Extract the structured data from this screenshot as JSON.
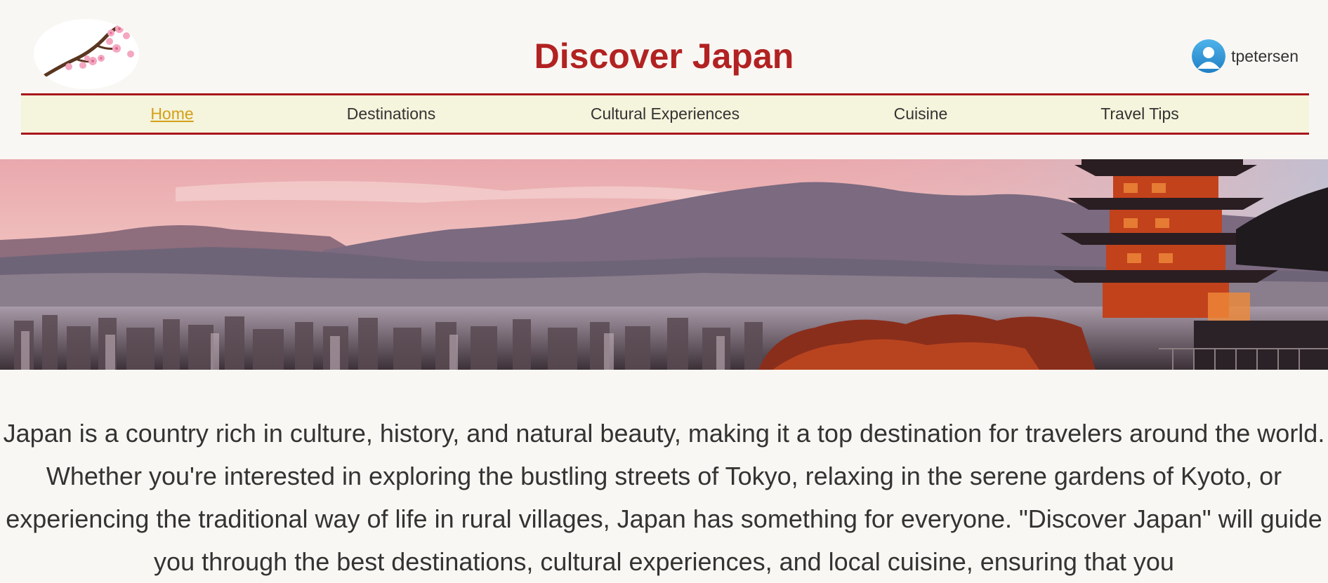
{
  "header": {
    "title": "Discover Japan",
    "logo_icon": "cherry-blossom-branch",
    "user": {
      "username": "tpetersen",
      "avatar_icon": "user-avatar-icon"
    }
  },
  "nav": {
    "items": [
      {
        "label": "Home",
        "active": true
      },
      {
        "label": "Destinations",
        "active": false
      },
      {
        "label": "Cultural Experiences",
        "active": false
      },
      {
        "label": "Cuisine",
        "active": false
      },
      {
        "label": "Travel Tips",
        "active": false
      }
    ]
  },
  "hero": {
    "image": "Kyoto skyline with mountains and pagoda at sunset"
  },
  "intro": {
    "text": "Japan is a country rich in culture, history, and natural beauty, making it a top destination for travelers around the world. Whether you're interested in exploring the bustling streets of Tokyo, relaxing in the serene gardens of Kyoto, or experiencing the traditional way of life in rural villages, Japan has something for everyone. \"Discover Japan\" will guide you through the best destinations, cultural experiences, and local cuisine, ensuring that you"
  },
  "colors": {
    "title": "#b22222",
    "nav_border": "#a8161b",
    "nav_bg": "#f5f4dc",
    "nav_active": "#d4a017",
    "page_bg": "#f9f7f3",
    "text": "#333333"
  }
}
